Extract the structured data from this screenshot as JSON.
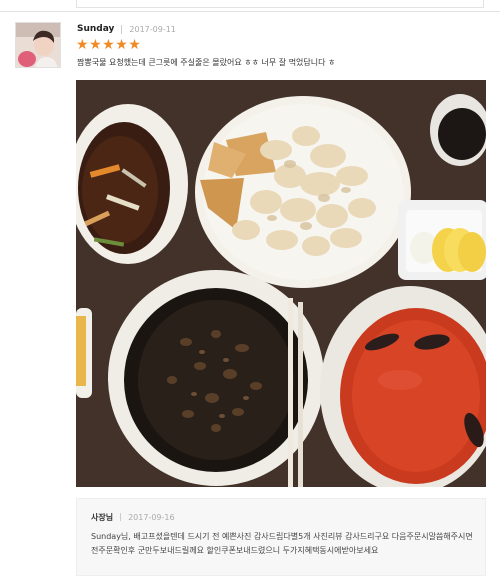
{
  "review": {
    "author": "Sunday",
    "date": "2017-09-11",
    "rating": 5,
    "star_glyph": "★",
    "star_color": "#f08a24",
    "text": "짬뽕국물 요청했는데 큰그릇에 주실줄은 몰랐어요 ㅎㅎ 너무 잘 먹었답니다 ㅎ"
  },
  "reply": {
    "author": "사장님",
    "date": "2017-09-16",
    "text": "Sunday님, 배고프셨을텐데 드시기 전 예쁜사진 감사드립다별5개 사진리뷰 감사드리구요 다음주문시말씀해주시면 전주문확인후 군만두보내드릴께요 할인쿠폰보내드렸으니 두가지혜택동시에받아보세요"
  }
}
